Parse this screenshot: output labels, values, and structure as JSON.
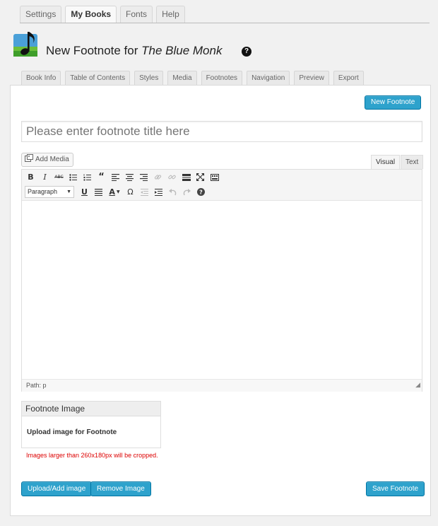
{
  "top_tabs": [
    "Settings",
    "My Books",
    "Fonts",
    "Help"
  ],
  "top_tab_active": "My Books",
  "header": {
    "title_prefix": "New Footnote for ",
    "book_title": "The Blue Monk",
    "help_glyph": "?"
  },
  "sub_tabs": [
    "Book Info",
    "Table of Contents",
    "Styles",
    "Media",
    "Footnotes",
    "Navigation",
    "Preview",
    "Export"
  ],
  "panel": {
    "new_footnote_label": "New Footnote",
    "title_placeholder": "Please enter footnote title here",
    "add_media_label": "Add Media",
    "mode_visual": "Visual",
    "mode_text": "Text",
    "format_select_value": "Paragraph",
    "path_label": "Path: p",
    "image_box_title": "Footnote Image",
    "image_box_text": "Upload image for Footnote",
    "warning_text": "Images larger than 260x180px will be cropped.",
    "upload_label": "Upload/Add image",
    "remove_label": "Remove Image",
    "save_label": "Save Footnote"
  },
  "icons": {
    "toolbar_row1": [
      "bold-icon",
      "italic-icon",
      "strikethrough-icon",
      "bullet-list-icon",
      "numbered-list-icon",
      "blockquote-icon",
      "align-left-icon",
      "align-center-icon",
      "align-right-icon",
      "link-icon",
      "unlink-icon",
      "read-more-icon",
      "fullscreen-icon",
      "toolbar-toggle-icon"
    ],
    "toolbar_row2": [
      "underline-icon",
      "justify-icon",
      "text-color-icon",
      "special-character-icon",
      "outdent-icon",
      "indent-icon",
      "undo-icon",
      "redo-icon",
      "help-icon"
    ]
  },
  "colors": {
    "accent": "#2ea2cc",
    "warning": "#dd0000"
  }
}
